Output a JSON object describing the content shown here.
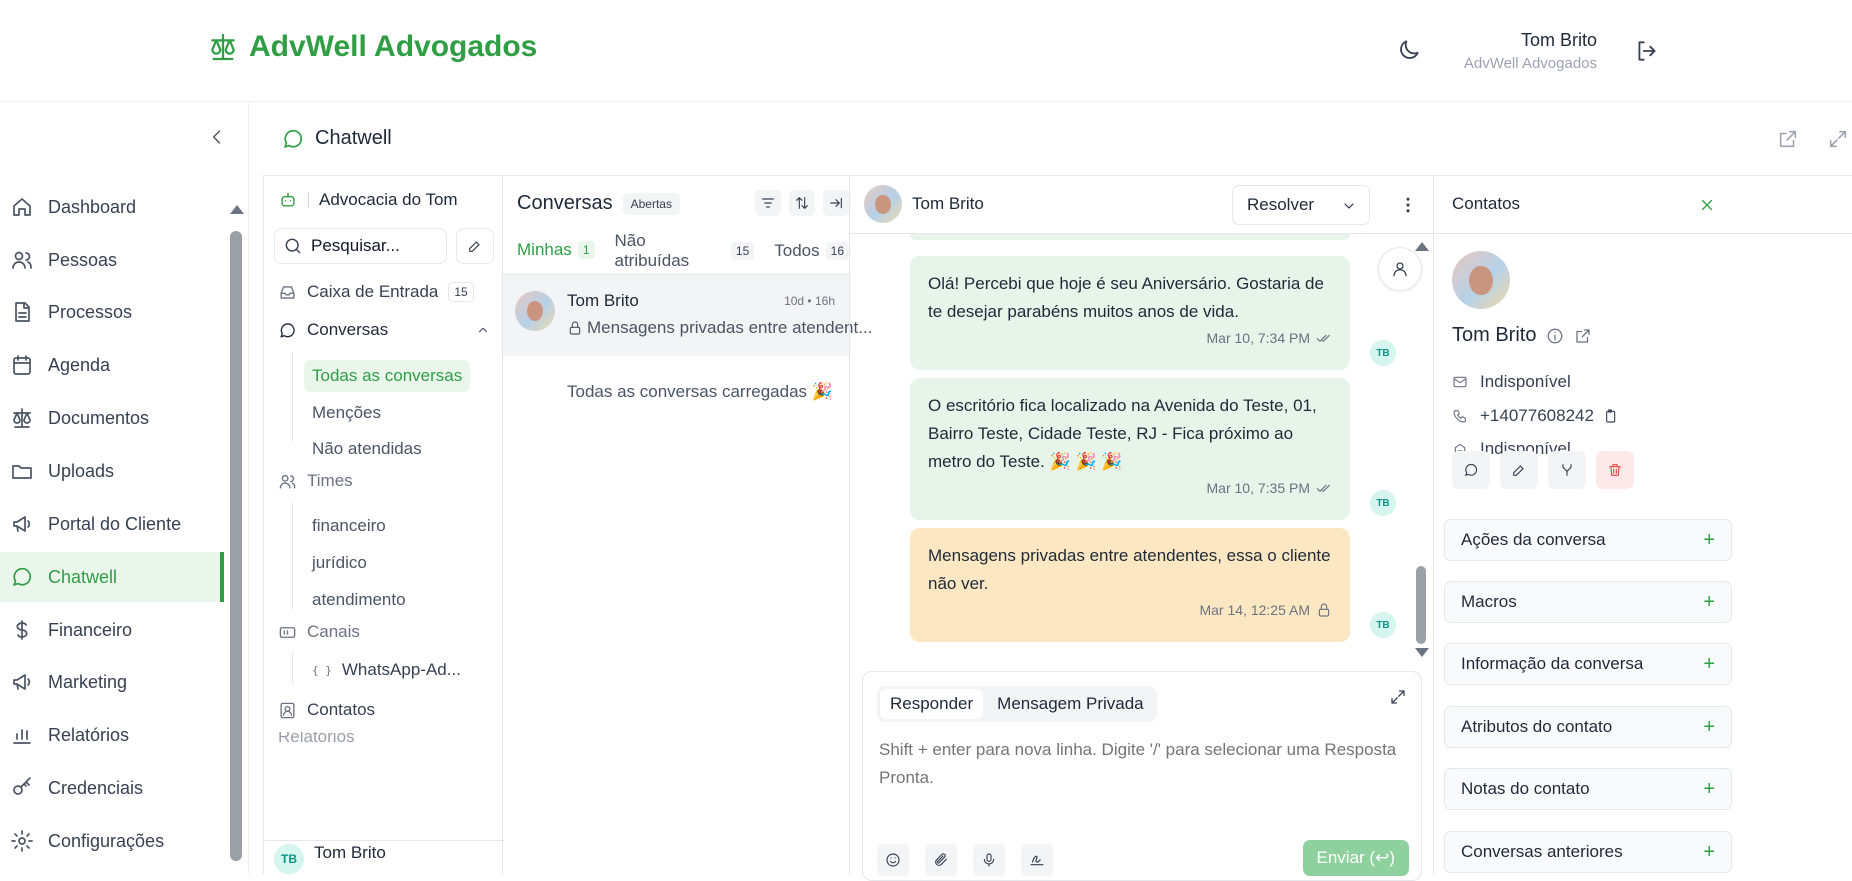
{
  "header": {
    "brand": "AdvWell Advogados",
    "user_name": "Tom Brito",
    "user_org": "AdvWell Advogados"
  },
  "sidebar": {
    "items": [
      {
        "label": "Dashboard",
        "icon": "home-icon"
      },
      {
        "label": "Pessoas",
        "icon": "users-icon"
      },
      {
        "label": "Processos",
        "icon": "file-icon"
      },
      {
        "label": "Agenda",
        "icon": "calendar-icon"
      },
      {
        "label": "Documentos",
        "icon": "scale-icon"
      },
      {
        "label": "Uploads",
        "icon": "folder-icon"
      },
      {
        "label": "Portal do Cliente",
        "icon": "megaphone-icon"
      },
      {
        "label": "Chatwell",
        "icon": "chat-icon",
        "active": true
      },
      {
        "label": "Financeiro",
        "icon": "dollar-icon"
      },
      {
        "label": "Marketing",
        "icon": "megaphone-icon"
      },
      {
        "label": "Relatórios",
        "icon": "bar-chart-icon"
      },
      {
        "label": "Credenciais",
        "icon": "key-icon"
      },
      {
        "label": "Configurações",
        "icon": "gear-icon"
      }
    ]
  },
  "page": {
    "title": "Chatwell"
  },
  "inbox": {
    "account": "Advocacia do Tom",
    "search_value": "Pesquisar...",
    "inbox_label": "Caixa de Entrada",
    "inbox_count": "15",
    "conversations_label": "Conversas",
    "sub": [
      "Todas as conversas",
      "Menções",
      "Não atendidas"
    ],
    "teams_label": "Times",
    "teams": [
      "financeiro",
      "jurídico",
      "atendimento"
    ],
    "channels_label": "Canais",
    "channel": "WhatsApp-Ad...",
    "contacts_label": "Contatos",
    "reports_label": "Relatórios",
    "user_initials": "TB",
    "user_name": "Tom Brito"
  },
  "list": {
    "title": "Conversas",
    "status": "Abertas",
    "tabs": [
      {
        "label": "Minhas",
        "count": "1"
      },
      {
        "label": "Não atribuídas",
        "count": "15"
      },
      {
        "label": "Todos",
        "count": "16"
      }
    ],
    "conversation": {
      "name": "Tom Brito",
      "time": "10d • 16h",
      "preview": "Mensagens privadas entre atendent..."
    },
    "loaded": "Todas as conversas carregadas 🎉"
  },
  "chat": {
    "contact": "Tom Brito",
    "resolve": "Resolver",
    "messages": [
      {
        "text": "Olá! Percebi que hoje é seu Aniversário. Gostaria de te desejar parabéns muitos anos de vida.",
        "time": "Mar 10, 7:34 PM",
        "initials": "TB"
      },
      {
        "text": "O escritório fica localizado na Avenida do Teste, 01, Bairro Teste, Cidade Teste, RJ - Fica próximo ao metro do Teste. 🎉 🎉 🎉",
        "time": "Mar 10, 7:35 PM",
        "initials": "TB"
      },
      {
        "text": "Mensagens privadas entre atendentes, essa o cliente não ver.",
        "time": "Mar 14, 12:25 AM",
        "initials": "TB"
      }
    ],
    "reply_tab": "Responder",
    "private_tab": "Mensagem Privada",
    "placeholder": "Shift + enter para nova linha. Digite '/' para selecionar uma Resposta Pronta.",
    "send": "Enviar (↩)"
  },
  "contact": {
    "title": "Contatos",
    "name": "Tom Brito",
    "email": "Indisponível",
    "phone": "+14077608242",
    "company": "Indisponível",
    "sections": [
      "Ações da conversa",
      "Macros",
      "Informação da conversa",
      "Atributos do contato",
      "Notas do contato",
      "Conversas anteriores"
    ]
  }
}
